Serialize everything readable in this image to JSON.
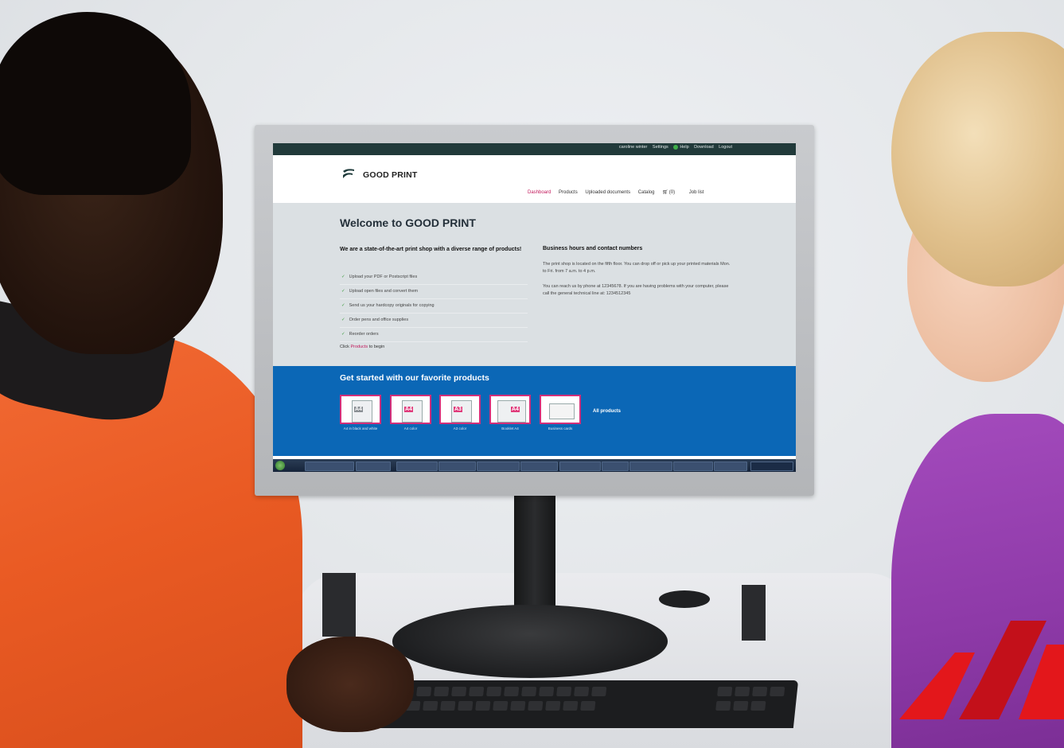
{
  "site": {
    "userbar": {
      "user": "caroline winter",
      "settings": "Settings",
      "help": "Help",
      "download": "Download",
      "logout": "Logout"
    },
    "brand": "GOOD PRINT",
    "nav": {
      "dashboard": "Dashboard",
      "products": "Products",
      "uploaded": "Uploaded documents",
      "catalog": "Catalog",
      "cart": "(0)",
      "joblist": "Job list"
    },
    "welcome": "Welcome to GOOD PRINT",
    "intro_heading": "We are a state-of-the-art print shop with a diverse range of products!",
    "features": [
      "Upload your PDF or Postscript files",
      "Upload open files and convert them",
      "Send us your hardcopy originals for copying",
      "Order pens and office supplies",
      "Reorder orders"
    ],
    "click_prefix": "Click",
    "click_link": "Products",
    "click_suffix": "to begin",
    "hours_heading": "Business hours and contact numbers",
    "hours_text1": "The print shop is located on the fifth floor. You can drop off or pick up your printed materials Mon. to Fri. from 7 a.m. to 4 p.m.",
    "hours_text2": "You can reach us by phone at 12345678. If you are having problems with your computer, please call the general technical line at: 1234512345",
    "products_heading": "Get started with our favorite products",
    "products": [
      {
        "badge": "A4",
        "label": "A4 in black and white"
      },
      {
        "badge": "A4",
        "label": "A4 color"
      },
      {
        "badge": "A3",
        "label": "A3 color"
      },
      {
        "badge": "A4",
        "label": "Booklet A4"
      },
      {
        "badge": "",
        "label": "Business cards"
      }
    ],
    "all_products": "All products"
  },
  "colors": {
    "topbar": "#213a3a",
    "accent": "#c2185b",
    "products_band": "#0b67b6",
    "shirt_left": "#e95a23",
    "shirt_right": "#8e3aa8",
    "corner_logo": "#e3171b"
  },
  "icons": [
    "good-print-logo-icon",
    "cart-icon",
    "help-icon",
    "check-icon",
    "windows-start-icon"
  ]
}
